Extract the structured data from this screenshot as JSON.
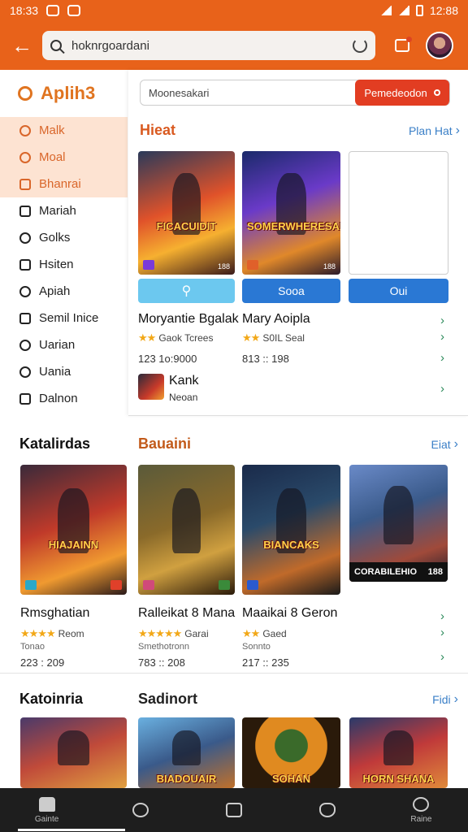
{
  "status": {
    "time_left": "18:33",
    "time_right": "12:88"
  },
  "appbar": {
    "search_text": "hoknrgoardani"
  },
  "sidebar": {
    "title": "Aplih3",
    "items": [
      {
        "label": "Malk",
        "active": true
      },
      {
        "label": "Moal",
        "active": true
      },
      {
        "label": "Bhanrai",
        "active": true
      },
      {
        "label": "Mariah",
        "active": false
      },
      {
        "label": "Golks",
        "active": false
      },
      {
        "label": "Hsiten",
        "active": false
      },
      {
        "label": "Apiah",
        "active": false
      },
      {
        "label": "Semil Inice",
        "active": false
      },
      {
        "label": "Uarian",
        "active": false
      },
      {
        "label": "Uania",
        "active": false
      },
      {
        "label": "Dalnon",
        "active": false
      }
    ]
  },
  "panel": {
    "search_placeholder": "Moonesakari",
    "search_button": "Pemedeodon",
    "section_title": "Hieat",
    "section_more": "Plan Hat",
    "cards": [
      {
        "label": "FICACUIDIT",
        "tag": "188"
      },
      {
        "label": "SOMERWHERESAN",
        "tag": "188"
      }
    ],
    "buttons": [
      "",
      "Sooa",
      "Oui"
    ],
    "app1": {
      "title": "Moryantie Bgalak",
      "rating_text": "Gaok Tcrees",
      "meta": "123 1o:9000"
    },
    "app2": {
      "title": "Mary Aoipla",
      "rating_text": "S0IL Seal",
      "meta": "813 :: 198"
    },
    "featured": {
      "title": "Kank",
      "subtitle": "Neoan"
    }
  },
  "section2": {
    "left_title": "Katalirdas",
    "title": "Bauaini",
    "more": "Eiat",
    "cards": [
      {
        "label": "HIAJAINN",
        "title": "Rmsghatian",
        "rating": "Reom",
        "sub": "Tonao",
        "meta": "223 : 209"
      },
      {
        "label": "",
        "title": "Ralleikat 8 Mana",
        "rating": "Garai",
        "sub": "Smethotronn",
        "meta": "783 :: 208"
      },
      {
        "label": "BIANCAKS",
        "title": "Maaikai 8 Geron",
        "rating": "Gaed",
        "sub": "Sonnto",
        "meta": "217 :: 235"
      },
      {
        "label": "CORABILEHIO",
        "tag": "188",
        "title": "",
        "rating": "",
        "sub": "",
        "meta": ""
      }
    ]
  },
  "section3": {
    "left_title": "Katoinria",
    "title": "Sadinort",
    "more": "Fidi",
    "cards": [
      {
        "label": "BIADOUAIR"
      },
      {
        "label": "SOHAN"
      },
      {
        "label": "HORN SHANA"
      }
    ]
  },
  "bottom_nav": [
    {
      "label": "Gainte"
    },
    {
      "label": ""
    },
    {
      "label": ""
    },
    {
      "label": ""
    },
    {
      "label": "Raine"
    }
  ]
}
